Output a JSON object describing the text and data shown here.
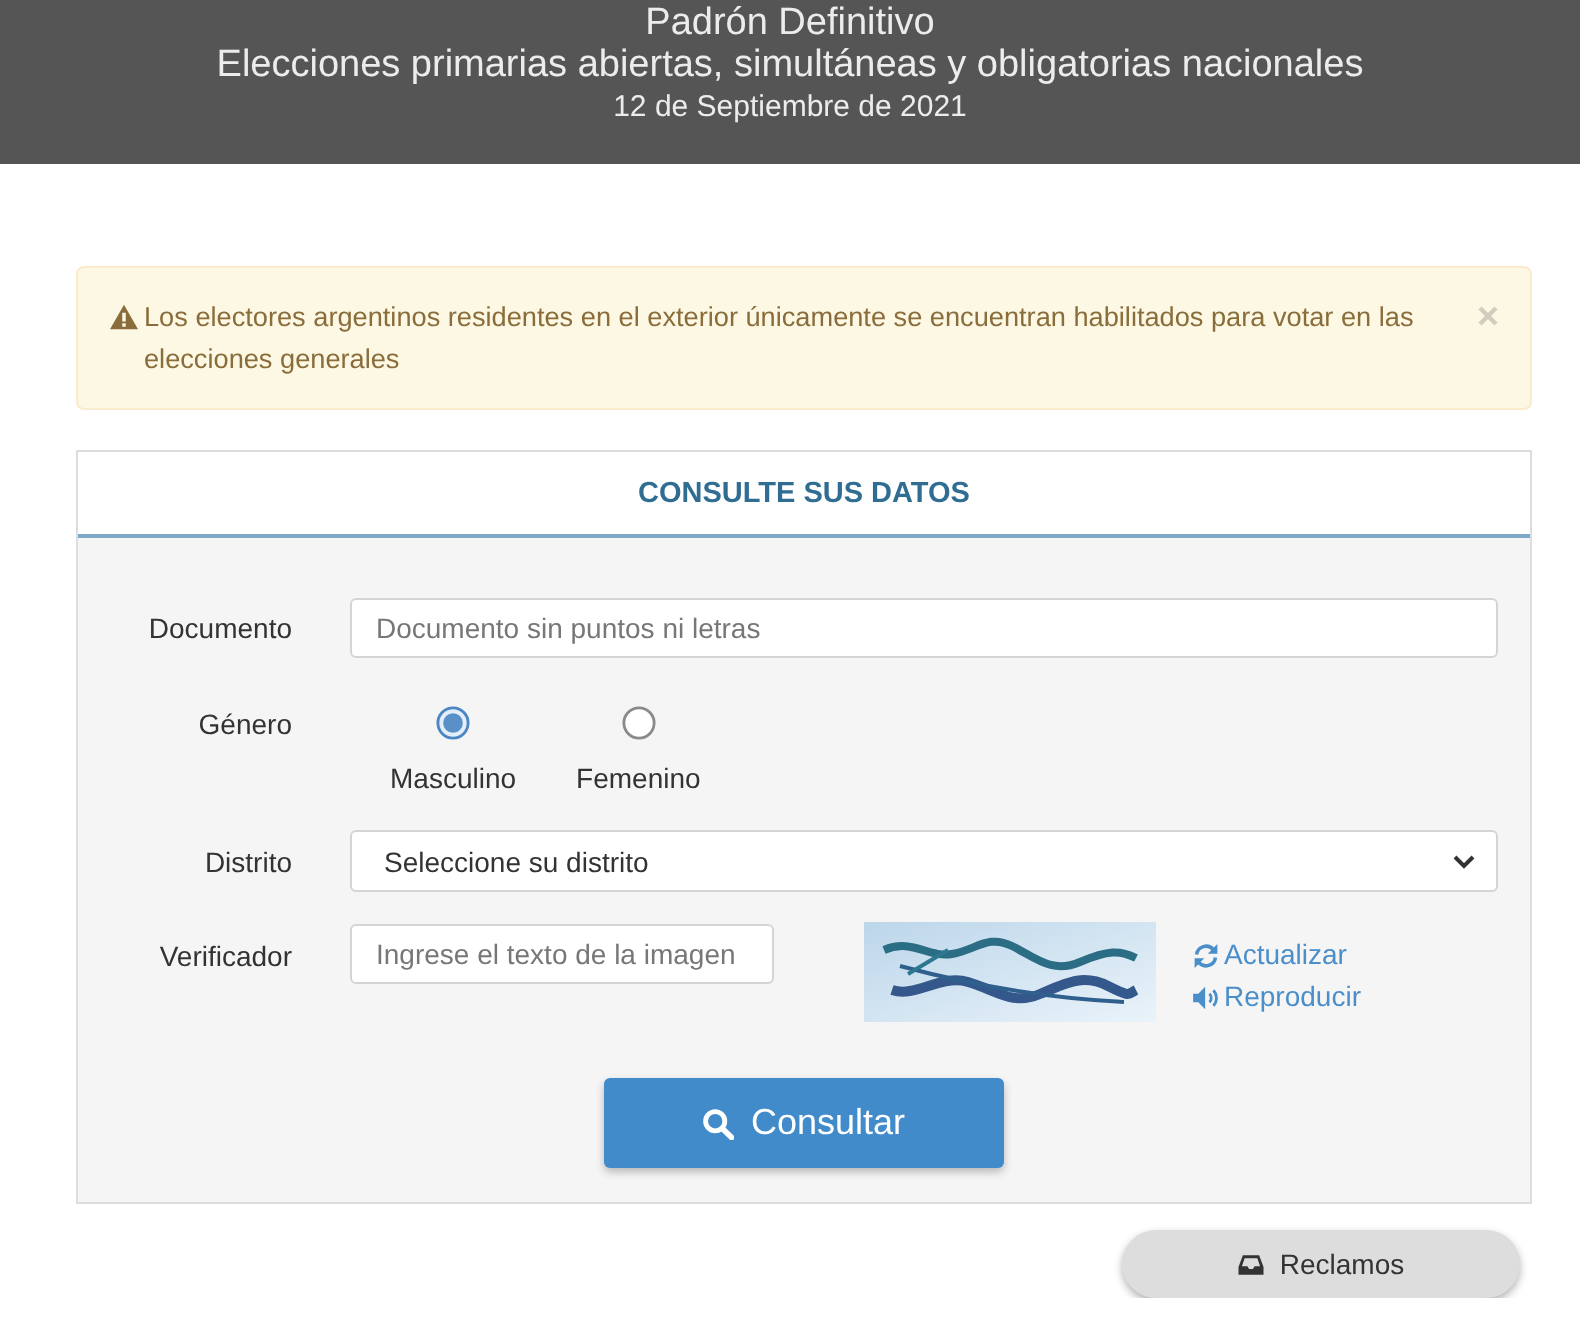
{
  "header": {
    "title": "Padrón Definitivo",
    "subtitle": "Elecciones primarias abiertas, simultáneas y obligatorias nacionales",
    "date": "12 de Septiembre de 2021"
  },
  "alert": {
    "message": "Los electores argentinos residentes en el exterior únicamente se encuentran habilitados para votar en las elecciones generales"
  },
  "form": {
    "title": "CONSULTE SUS DATOS",
    "fields": [
      {
        "kind": "text",
        "label": "Documento",
        "placeholder": "Documento sin puntos ni letras"
      },
      {
        "kind": "radio",
        "label": "Género",
        "options": [
          {
            "label": "Masculino",
            "selected": true
          },
          {
            "label": "Femenino",
            "selected": false
          }
        ]
      },
      {
        "kind": "select",
        "label": "Distrito",
        "value": "Seleccione su distrito"
      },
      {
        "kind": "captcha",
        "label": "Verificador",
        "placeholder": "Ingrese el texto de la imagen",
        "links": [
          {
            "kind": "refresh",
            "label": "Actualizar"
          },
          {
            "kind": "audio",
            "label": "Reproducir"
          }
        ]
      }
    ],
    "submit": "Consultar"
  },
  "complaints": {
    "label": "Reclamos"
  }
}
